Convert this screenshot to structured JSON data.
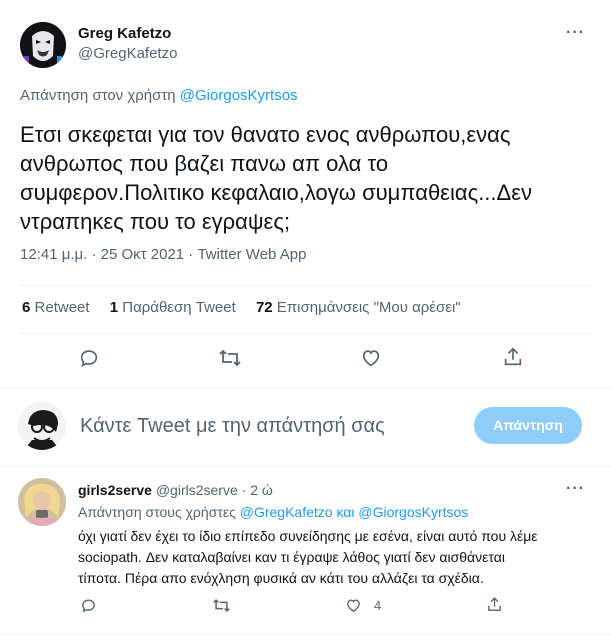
{
  "tweet": {
    "author_name": "Greg Kafetzo",
    "author_handle": "@GregKafetzo",
    "reply_prefix": "Απάντηση στον χρήστη",
    "reply_to": "@GiorgosKyrtsos",
    "text_lines": [
      "Ετσι σκεφεται για τον θανατο ενος ανθρωπου,ενας",
      "ανθρωπος που βαζει πανω απ ολα το",
      "συμφερον.Πολιτικο κεφαλαιο,λογω συμπαθειας...Δεν",
      "ντραπηκες που το εγραψες;"
    ],
    "time": "12:41 μ.μ. · 25 Οκτ 2021 · Twitter Web App",
    "stats": {
      "retweets_count": "6",
      "retweets_label": "Retweet",
      "quotes_count": "1",
      "quotes_label": "Παράθεση Tweet",
      "likes_count": "72",
      "likes_label": "Επισημάνσεις \"Μου αρέσει\""
    },
    "more_label": "···"
  },
  "composer": {
    "placeholder": "Κάντε Tweet με την απάντησή σας",
    "button_label": "Απάντηση"
  },
  "reply": {
    "author_name": "girls2serve",
    "author_handle": "@girls2serve",
    "separator": "·",
    "time": "2 ώ",
    "reply_prefix": "Απάντηση στους χρήστες",
    "reply_to_1": "@GregKafetzo",
    "reply_and": "και",
    "reply_to_2": "@GiorgosKyrtsos",
    "text_lines": [
      "όχι γιατί δεν έχει το ίδιο επίπεδο συνείδησης με εσένα, είναι αυτό που λέμε",
      "sociopath. Δεν καταλαβαίνει καν τι έγραψε λάθος γιατί δεν αισθάνεται",
      "τίποτα. Πέρα απο ενόχληση φυσικά αν κάτι του αλλάζει τα σχέδια."
    ],
    "likes_count": "4",
    "more_label": "···"
  },
  "colors": {
    "accent": "#1d9bf0",
    "muted": "#536471",
    "button_disabled": "#8ecdf7"
  },
  "icons": [
    "reply-icon",
    "retweet-icon",
    "like-icon",
    "share-icon",
    "more-icon"
  ]
}
